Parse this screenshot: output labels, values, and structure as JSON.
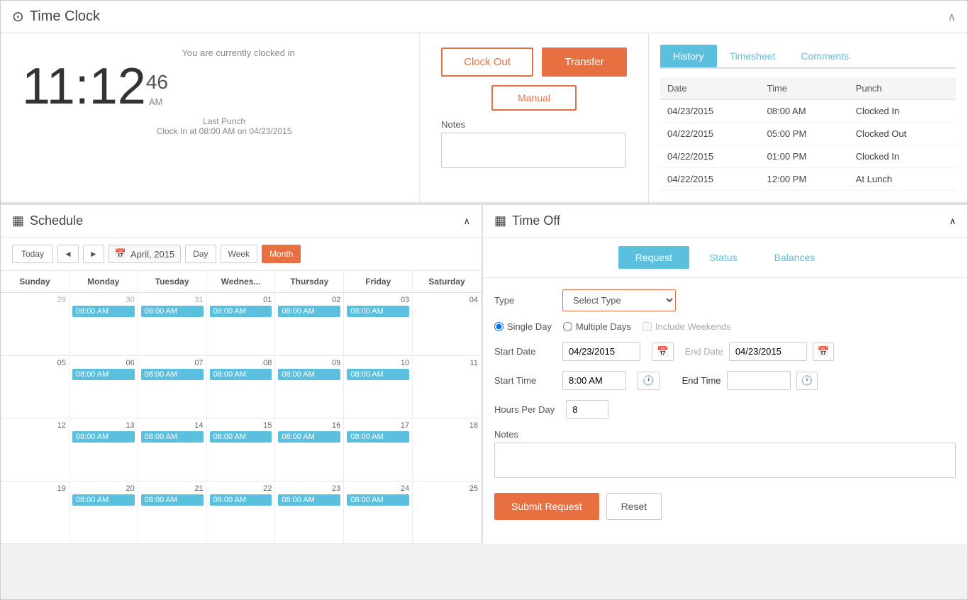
{
  "header": {
    "title": "Time Clock",
    "clock_icon": "⊙",
    "collapse_icon": "∧"
  },
  "clock_panel": {
    "status_text": "You are currently clocked in",
    "hour": "11",
    "minute": "12",
    "seconds": "46",
    "ampm": "AM",
    "last_punch_label": "Last Punch",
    "last_punch_detail": "Clock In at 08:00 AM on 04/23/2015"
  },
  "actions": {
    "clock_out_label": "Clock Out",
    "transfer_label": "Transfer",
    "manual_label": "Manual",
    "notes_label": "Notes",
    "notes_placeholder": ""
  },
  "history": {
    "tabs": [
      {
        "label": "History",
        "active": true
      },
      {
        "label": "Timesheet",
        "active": false
      },
      {
        "label": "Comments",
        "active": false
      }
    ],
    "columns": [
      "Date",
      "Time",
      "Punch"
    ],
    "rows": [
      {
        "date": "04/23/2015",
        "time": "08:00 AM",
        "punch": "Clocked In"
      },
      {
        "date": "04/22/2015",
        "time": "05:00 PM",
        "punch": "Clocked Out"
      },
      {
        "date": "04/22/2015",
        "time": "01:00 PM",
        "punch": "Clocked In"
      },
      {
        "date": "04/22/2015",
        "time": "12:00 PM",
        "punch": "At Lunch"
      }
    ]
  },
  "schedule": {
    "title": "Schedule",
    "icon": "▦",
    "toolbar": {
      "today": "Today",
      "prev": "◄",
      "next": "►",
      "month_label": "April, 2015",
      "view_day": "Day",
      "view_week": "Week",
      "view_month": "Month"
    },
    "day_headers": [
      "Sunday",
      "Monday",
      "Tuesday",
      "Wednes...",
      "Thursday",
      "Friday",
      "Saturday"
    ],
    "weeks": [
      {
        "days": [
          {
            "num": "29",
            "current": false,
            "events": []
          },
          {
            "num": "30",
            "current": false,
            "events": [
              "08:00 AM"
            ]
          },
          {
            "num": "31",
            "current": false,
            "events": [
              "08:00 AM"
            ]
          },
          {
            "num": "01",
            "current": true,
            "events": [
              "08:00 AM"
            ]
          },
          {
            "num": "02",
            "current": true,
            "events": [
              "08:00 AM"
            ]
          },
          {
            "num": "03",
            "current": true,
            "events": [
              "08:00 AM"
            ]
          },
          {
            "num": "04",
            "current": true,
            "events": []
          }
        ]
      },
      {
        "days": [
          {
            "num": "05",
            "current": true,
            "events": []
          },
          {
            "num": "06",
            "current": true,
            "events": [
              "08:00 AM"
            ]
          },
          {
            "num": "07",
            "current": true,
            "events": [
              "08:00 AM"
            ]
          },
          {
            "num": "08",
            "current": true,
            "events": [
              "08:00 AM"
            ]
          },
          {
            "num": "09",
            "current": true,
            "events": [
              "08:00 AM"
            ]
          },
          {
            "num": "10",
            "current": true,
            "events": [
              "08:00 AM"
            ]
          },
          {
            "num": "11",
            "current": true,
            "events": []
          }
        ]
      },
      {
        "days": [
          {
            "num": "12",
            "current": true,
            "events": []
          },
          {
            "num": "13",
            "current": true,
            "events": [
              "08:00 AM"
            ]
          },
          {
            "num": "14",
            "current": true,
            "events": [
              "08:00 AM"
            ]
          },
          {
            "num": "15",
            "current": true,
            "events": [
              "08:00 AM"
            ]
          },
          {
            "num": "16",
            "current": true,
            "events": [
              "08:00 AM"
            ]
          },
          {
            "num": "17",
            "current": true,
            "events": [
              "08:00 AM"
            ]
          },
          {
            "num": "18",
            "current": true,
            "events": []
          }
        ]
      },
      {
        "days": [
          {
            "num": "19",
            "current": true,
            "events": []
          },
          {
            "num": "20",
            "current": true,
            "events": [
              "08:00 AM"
            ]
          },
          {
            "num": "21",
            "current": true,
            "events": [
              "08:00 AM"
            ]
          },
          {
            "num": "22",
            "current": true,
            "events": [
              "08:00 AM"
            ]
          },
          {
            "num": "23",
            "current": true,
            "events": [
              "08:00 AM"
            ]
          },
          {
            "num": "24",
            "current": true,
            "events": [
              "08:00 AM"
            ]
          },
          {
            "num": "25",
            "current": true,
            "events": []
          }
        ]
      }
    ]
  },
  "timeoff": {
    "title": "Time Off",
    "icon": "▦",
    "tabs": [
      {
        "label": "Request",
        "active": true
      },
      {
        "label": "Status",
        "active": false
      },
      {
        "label": "Balances",
        "active": false
      }
    ],
    "form": {
      "type_label": "Type",
      "type_placeholder": "Select Type",
      "single_day_label": "Single Day",
      "multiple_days_label": "Multiple Days",
      "include_weekends_label": "Include Weekends",
      "start_date_label": "Start Date",
      "start_date_value": "04/23/2015",
      "end_date_label": "End Date",
      "end_date_value": "04/23/2015",
      "start_time_label": "Start Time",
      "start_time_value": "8:00 AM",
      "end_time_label": "End Time",
      "end_time_value": "",
      "hours_label": "Hours Per Day",
      "hours_value": "8",
      "notes_label": "Notes",
      "submit_label": "Submit Request",
      "reset_label": "Reset"
    }
  }
}
